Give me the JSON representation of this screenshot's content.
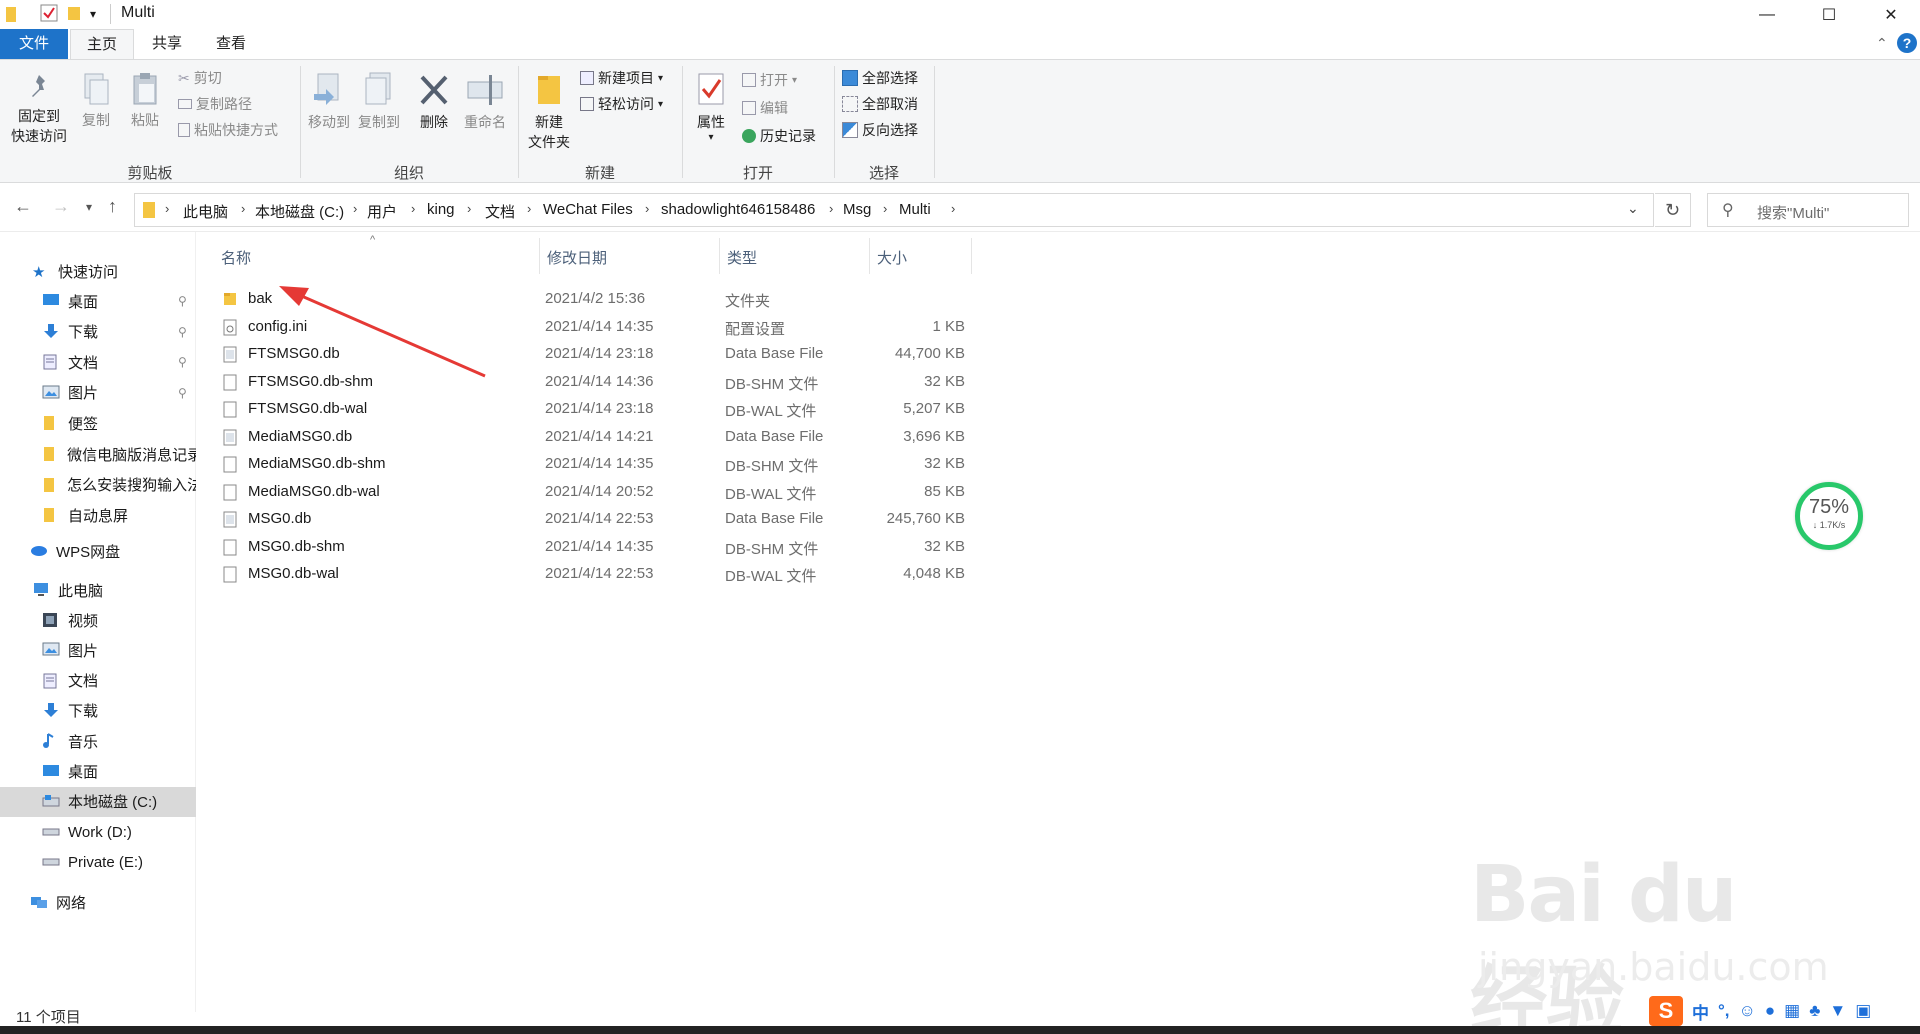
{
  "window": {
    "title": "Multi",
    "quick_access_dropdown": "▾",
    "controls": {
      "minimize": "—",
      "maximize": "☐",
      "close": "✕"
    }
  },
  "ribbon_tabs": [
    {
      "label": "文件",
      "kind": "file"
    },
    {
      "label": "主页",
      "kind": "active"
    },
    {
      "label": "共享",
      "kind": "normal"
    },
    {
      "label": "查看",
      "kind": "normal"
    }
  ],
  "ribbon": {
    "clipboard": {
      "label": "剪贴板",
      "pin_line1": "固定到",
      "pin_line2": "快速访问",
      "copy": "复制",
      "paste": "粘贴",
      "cut": "剪切",
      "copy_path": "复制路径",
      "paste_shortcut": "粘贴快捷方式"
    },
    "organize": {
      "label": "组织",
      "move_to": "移动到",
      "copy_to": "复制到",
      "delete": "删除",
      "rename": "重命名"
    },
    "new": {
      "label": "新建",
      "new_folder_line1": "新建",
      "new_folder_line2": "文件夹",
      "new_item": "新建项目",
      "easy_access": "轻松访问"
    },
    "open": {
      "label": "打开",
      "properties": "属性",
      "open": "打开",
      "edit": "编辑",
      "history": "历史记录"
    },
    "select": {
      "label": "选择",
      "select_all": "全部选择",
      "select_none": "全部取消",
      "invert": "反向选择"
    }
  },
  "address": {
    "breadcrumbs": [
      "此电脑",
      "本地磁盘 (C:)",
      "用户",
      "king",
      "文档",
      "WeChat Files",
      "shadowlight646158486",
      "Msg",
      "Multi"
    ],
    "search_placeholder": "搜索\"Multi\""
  },
  "sidebar": {
    "quick_access": "快速访问",
    "quick_items": [
      {
        "label": "桌面",
        "icon": "desktop-icon",
        "pinned": true
      },
      {
        "label": "下载",
        "icon": "download-icon",
        "pinned": true
      },
      {
        "label": "文档",
        "icon": "document-icon",
        "pinned": true
      },
      {
        "label": "图片",
        "icon": "picture-icon",
        "pinned": true
      },
      {
        "label": "便签",
        "icon": "folder-icon",
        "pinned": false
      },
      {
        "label": "微信电脑版消息记录",
        "icon": "folder-icon",
        "pinned": false
      },
      {
        "label": "怎么安装搜狗输入法",
        "icon": "folder-icon",
        "pinned": false
      },
      {
        "label": "自动息屏",
        "icon": "folder-icon",
        "pinned": false
      }
    ],
    "wps": "WPS网盘",
    "this_pc": "此电脑",
    "pc_items": [
      {
        "label": "视频",
        "icon": "video-icon",
        "selected": false
      },
      {
        "label": "图片",
        "icon": "picture-icon",
        "selected": false
      },
      {
        "label": "文档",
        "icon": "document-icon",
        "selected": false
      },
      {
        "label": "下载",
        "icon": "download-icon",
        "selected": false
      },
      {
        "label": "音乐",
        "icon": "music-icon",
        "selected": false
      },
      {
        "label": "桌面",
        "icon": "desktop-icon",
        "selected": false
      },
      {
        "label": "本地磁盘 (C:)",
        "icon": "drive-c-icon",
        "selected": true
      },
      {
        "label": "Work (D:)",
        "icon": "drive-icon",
        "selected": false
      },
      {
        "label": "Private (E:)",
        "icon": "drive-icon",
        "selected": false
      }
    ],
    "network": "网络"
  },
  "columns": {
    "name": "名称",
    "date": "修改日期",
    "type": "类型",
    "size": "大小"
  },
  "files": [
    {
      "name": "bak",
      "date": "2021/4/2 15:36",
      "type": "文件夹",
      "size": "",
      "icon": "folder-icon"
    },
    {
      "name": "config.ini",
      "date": "2021/4/14 14:35",
      "type": "配置设置",
      "size": "1 KB",
      "icon": "settings-file-icon"
    },
    {
      "name": "FTSMSG0.db",
      "date": "2021/4/14 23:18",
      "type": "Data Base File",
      "size": "44,700 KB",
      "icon": "db-file-icon"
    },
    {
      "name": "FTSMSG0.db-shm",
      "date": "2021/4/14 14:36",
      "type": "DB-SHM 文件",
      "size": "32 KB",
      "icon": "file-icon"
    },
    {
      "name": "FTSMSG0.db-wal",
      "date": "2021/4/14 23:18",
      "type": "DB-WAL 文件",
      "size": "5,207 KB",
      "icon": "file-icon"
    },
    {
      "name": "MediaMSG0.db",
      "date": "2021/4/14 14:21",
      "type": "Data Base File",
      "size": "3,696 KB",
      "icon": "db-file-icon"
    },
    {
      "name": "MediaMSG0.db-shm",
      "date": "2021/4/14 14:35",
      "type": "DB-SHM 文件",
      "size": "32 KB",
      "icon": "file-icon"
    },
    {
      "name": "MediaMSG0.db-wal",
      "date": "2021/4/14 20:52",
      "type": "DB-WAL 文件",
      "size": "85 KB",
      "icon": "file-icon"
    },
    {
      "name": "MSG0.db",
      "date": "2021/4/14 22:53",
      "type": "Data Base File",
      "size": "245,760 KB",
      "icon": "db-file-icon"
    },
    {
      "name": "MSG0.db-shm",
      "date": "2021/4/14 14:35",
      "type": "DB-SHM 文件",
      "size": "32 KB",
      "icon": "file-icon"
    },
    {
      "name": "MSG0.db-wal",
      "date": "2021/4/14 22:53",
      "type": "DB-WAL 文件",
      "size": "4,048 KB",
      "icon": "file-icon"
    }
  ],
  "status": {
    "item_count": "11 个项目"
  },
  "gauge": {
    "percent": "75%",
    "speed": "↓ 1.7K/s"
  },
  "ime": {
    "mode": "中",
    "punct": "°,"
  },
  "watermark": {
    "brand": "Bai du 经验",
    "url": "jingyan.baidu.com"
  },
  "colors": {
    "accent": "#1e73c9",
    "arrow": "#e53935",
    "gauge": "#28c86a"
  }
}
